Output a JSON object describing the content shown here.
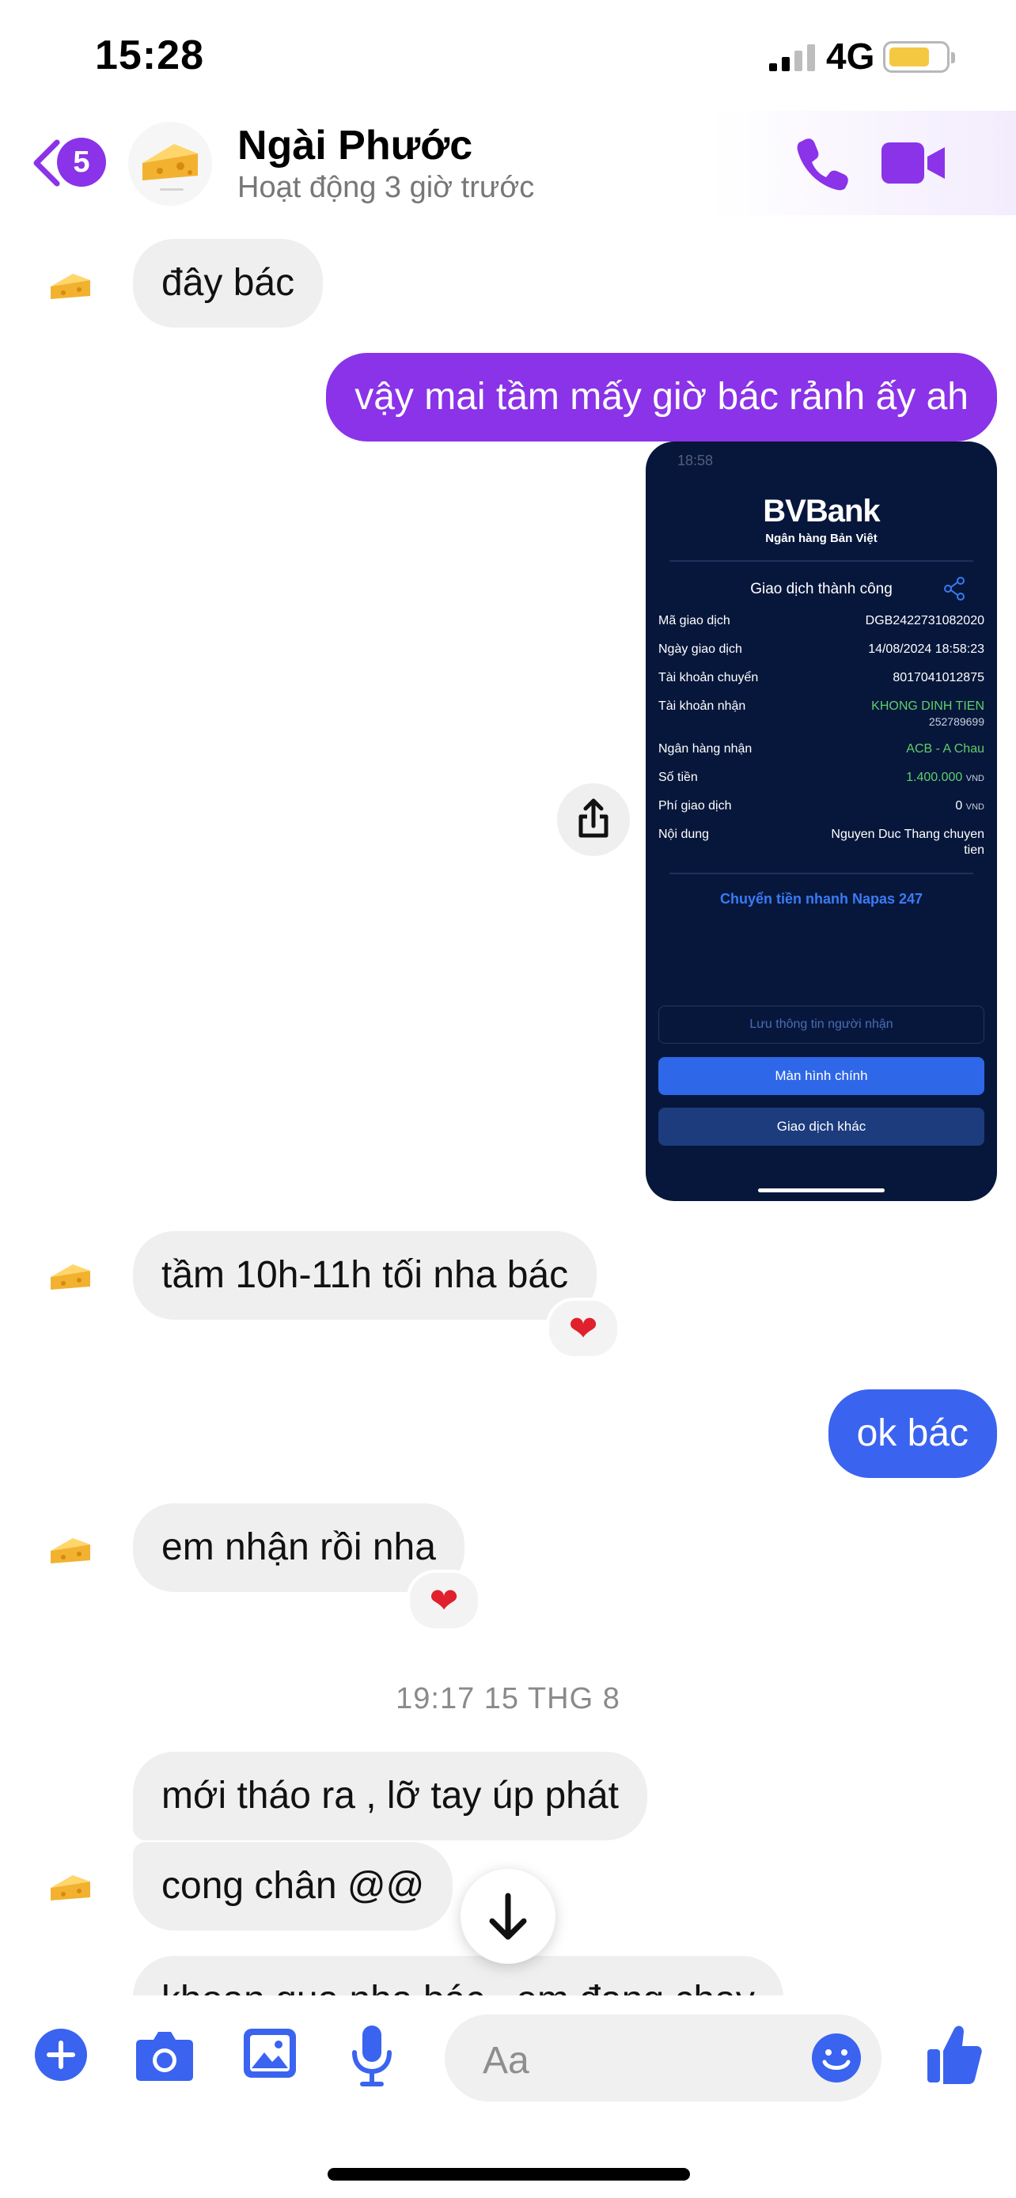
{
  "status_bar": {
    "time": "15:28",
    "network": "4G"
  },
  "header": {
    "unread_count": "5",
    "contact_name": "Ngài Phước",
    "contact_status": "Hoạt động 3 giờ trước"
  },
  "messages": {
    "m1": "đây bác",
    "m2": "vậy mai tầm mấy giờ bác rảnh ấy ah",
    "m3": "tầm 10h-11h tối nha bác",
    "m4": "ok bác",
    "m5": "em nhận rồi nha",
    "timestamp": "19:17 15 THG 8",
    "m6": "mới tháo ra , lỡ tay úp phát",
    "m7": "cong chân @@",
    "m8": "khoan qua nha bác , em đang chay"
  },
  "receipt": {
    "time": "18:58",
    "bank_name": "BVBank",
    "bank_sub": "Ngân hàng Bản Việt",
    "title": "Giao dịch thành công",
    "rows": [
      {
        "label": "Mã giao dịch",
        "value": "DGB2422731082020"
      },
      {
        "label": "Ngày giao dịch",
        "value": "14/08/2024 18:58:23"
      },
      {
        "label": "Tài khoản chuyển",
        "value": "8017041012875"
      },
      {
        "label": "Tài khoản nhận",
        "value": "KHONG DINH TIEN",
        "sub": "252789699"
      },
      {
        "label": "Ngân hàng nhận",
        "value": "ACB - A Chau"
      },
      {
        "label": "Số tiền",
        "value": "1.400.000",
        "unit": "VND"
      },
      {
        "label": "Phí giao dịch",
        "value": "0",
        "unit": "VND"
      },
      {
        "label": "Nội dung",
        "value": "Nguyen Duc Thang chuyen",
        "sub": "tien"
      }
    ],
    "napas": "Chuyển tiền nhanh Napas 247",
    "save_recipient": "Lưu thông tin người nhận",
    "home_button": "Màn hình chính",
    "other_button": "Giao dịch khác"
  },
  "composer": {
    "placeholder": "Aa"
  },
  "colors": {
    "accent_purple": "#8a33e8",
    "accent_blue": "#3a63f0",
    "bubble_gray": "#efefef"
  }
}
